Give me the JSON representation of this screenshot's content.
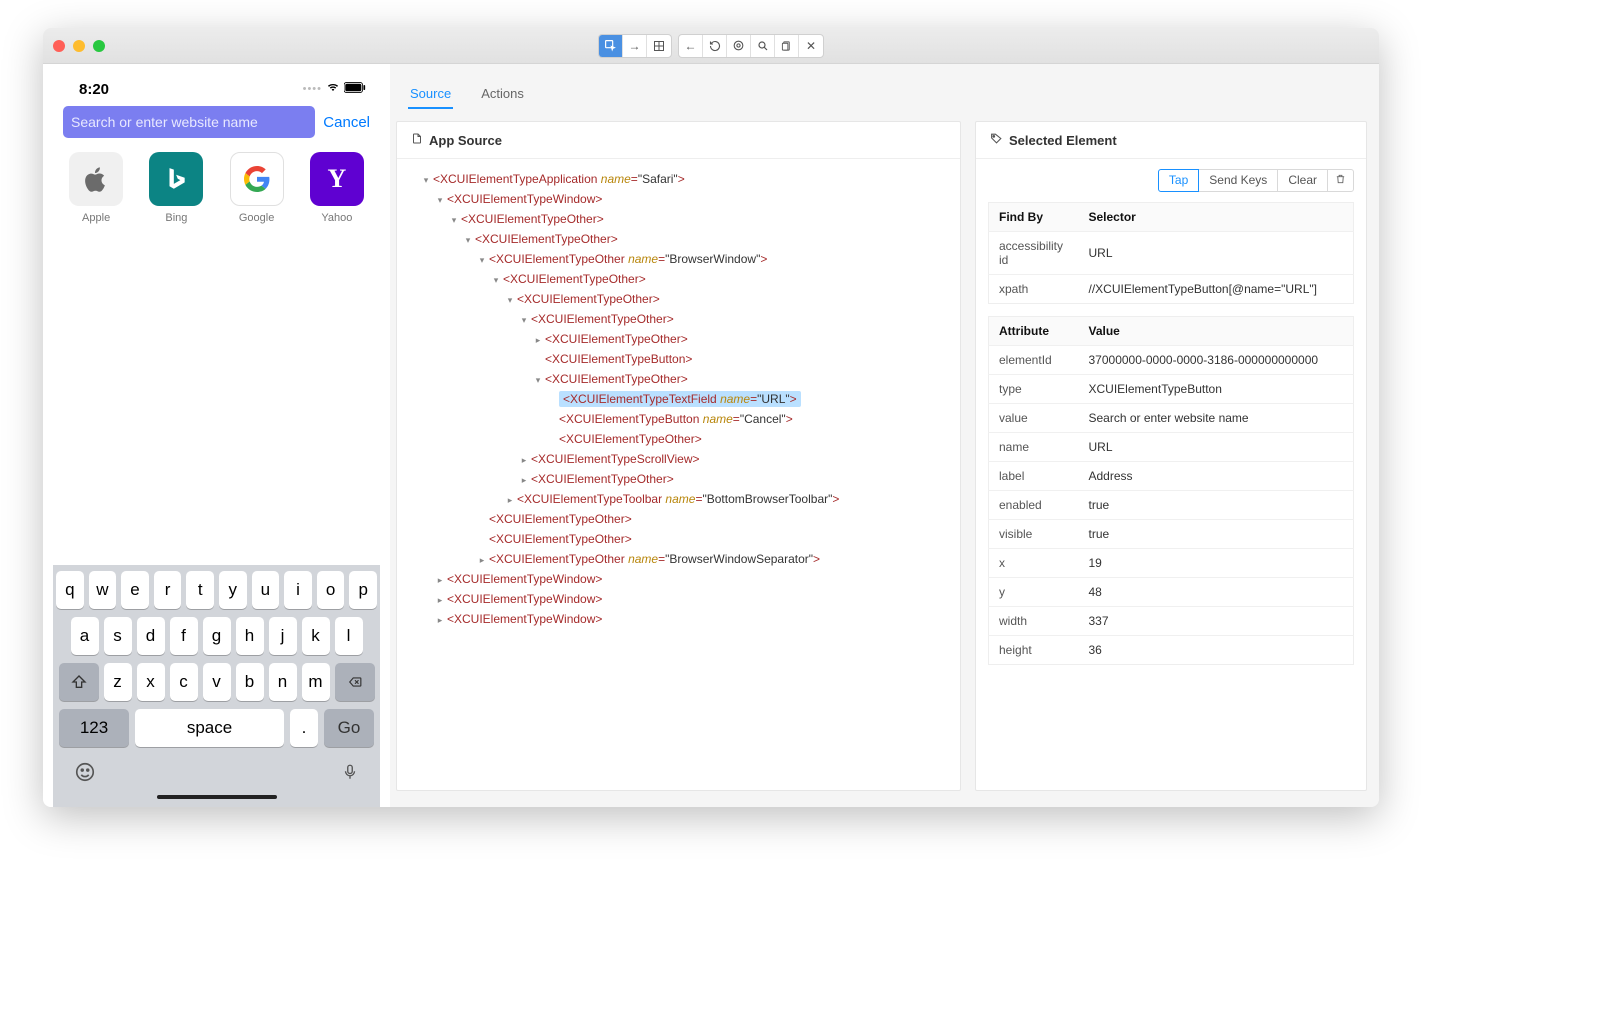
{
  "tabs": {
    "source": "Source",
    "actions": "Actions"
  },
  "source_panel_title": "App Source",
  "selected_panel_title": "Selected Element",
  "sel_actions": {
    "tap": "Tap",
    "send_keys": "Send Keys",
    "clear": "Clear"
  },
  "findby_header": {
    "col1": "Find By",
    "col2": "Selector"
  },
  "findby_rows": [
    {
      "k": "accessibility id",
      "v": "URL"
    },
    {
      "k": "xpath",
      "v": "//XCUIElementTypeButton[@name=\"URL\"]"
    }
  ],
  "attr_header": {
    "col1": "Attribute",
    "col2": "Value"
  },
  "attr_rows": [
    {
      "k": "elementId",
      "v": "37000000-0000-0000-3186-000000000000"
    },
    {
      "k": "type",
      "v": "XCUIElementTypeButton"
    },
    {
      "k": "value",
      "v": "Search or enter website name"
    },
    {
      "k": "name",
      "v": "URL"
    },
    {
      "k": "label",
      "v": "Address"
    },
    {
      "k": "enabled",
      "v": "true"
    },
    {
      "k": "visible",
      "v": "true"
    },
    {
      "k": "x",
      "v": "19"
    },
    {
      "k": "y",
      "v": "48"
    },
    {
      "k": "width",
      "v": "337"
    },
    {
      "k": "height",
      "v": "36"
    }
  ],
  "tree": [
    {
      "d": 1,
      "tw": "▾",
      "tag": "XCUIElementTypeApplication",
      "attr": "name",
      "val": "Safari"
    },
    {
      "d": 2,
      "tw": "▾",
      "tag": "XCUIElementTypeWindow"
    },
    {
      "d": 3,
      "tw": "▾",
      "tag": "XCUIElementTypeOther"
    },
    {
      "d": 4,
      "tw": "▾",
      "tag": "XCUIElementTypeOther"
    },
    {
      "d": 5,
      "tw": "▾",
      "tag": "XCUIElementTypeOther",
      "attr": "name",
      "val": "BrowserWindow"
    },
    {
      "d": 6,
      "tw": "▾",
      "tag": "XCUIElementTypeOther"
    },
    {
      "d": 7,
      "tw": "▾",
      "tag": "XCUIElementTypeOther"
    },
    {
      "d": 8,
      "tw": "▾",
      "tag": "XCUIElementTypeOther"
    },
    {
      "d": 9,
      "tw": "▸",
      "tag": "XCUIElementTypeOther"
    },
    {
      "d": 9,
      "tw": "",
      "tag": "XCUIElementTypeButton"
    },
    {
      "d": 9,
      "tw": "▾",
      "tag": "XCUIElementTypeOther"
    },
    {
      "d": 10,
      "tw": "",
      "tag": "XCUIElementTypeTextField",
      "attr": "name",
      "val": "URL",
      "sel": true
    },
    {
      "d": 10,
      "tw": "",
      "tag": "XCUIElementTypeButton",
      "attr": "name",
      "val": "Cancel"
    },
    {
      "d": 10,
      "tw": "",
      "tag": "XCUIElementTypeOther"
    },
    {
      "d": 8,
      "tw": "▸",
      "tag": "XCUIElementTypeScrollView"
    },
    {
      "d": 8,
      "tw": "▸",
      "tag": "XCUIElementTypeOther"
    },
    {
      "d": 7,
      "tw": "▸",
      "tag": "XCUIElementTypeToolbar",
      "attr": "name",
      "val": "BottomBrowserToolbar"
    },
    {
      "d": 5,
      "tw": "",
      "tag": "XCUIElementTypeOther"
    },
    {
      "d": 5,
      "tw": "",
      "tag": "XCUIElementTypeOther"
    },
    {
      "d": 5,
      "tw": "▸",
      "tag": "XCUIElementTypeOther",
      "attr": "name",
      "val": "BrowserWindowSeparator"
    },
    {
      "d": 2,
      "tw": "▸",
      "tag": "XCUIElementTypeWindow"
    },
    {
      "d": 2,
      "tw": "▸",
      "tag": "XCUIElementTypeWindow"
    },
    {
      "d": 2,
      "tw": "▸",
      "tag": "XCUIElementTypeWindow"
    }
  ],
  "phone": {
    "time": "8:20",
    "search_placeholder": "Search or enter website name",
    "cancel": "Cancel",
    "favs": [
      {
        "label": "Apple"
      },
      {
        "label": "Bing"
      },
      {
        "label": "Google"
      },
      {
        "label": "Yahoo"
      }
    ],
    "keys_r1": [
      "q",
      "w",
      "e",
      "r",
      "t",
      "y",
      "u",
      "i",
      "o",
      "p"
    ],
    "keys_r2": [
      "a",
      "s",
      "d",
      "f",
      "g",
      "h",
      "j",
      "k",
      "l"
    ],
    "keys_r3": [
      "z",
      "x",
      "c",
      "v",
      "b",
      "n",
      "m"
    ],
    "num_key": "123",
    "space_key": "space",
    "period_key": ".",
    "go_key": "Go"
  }
}
